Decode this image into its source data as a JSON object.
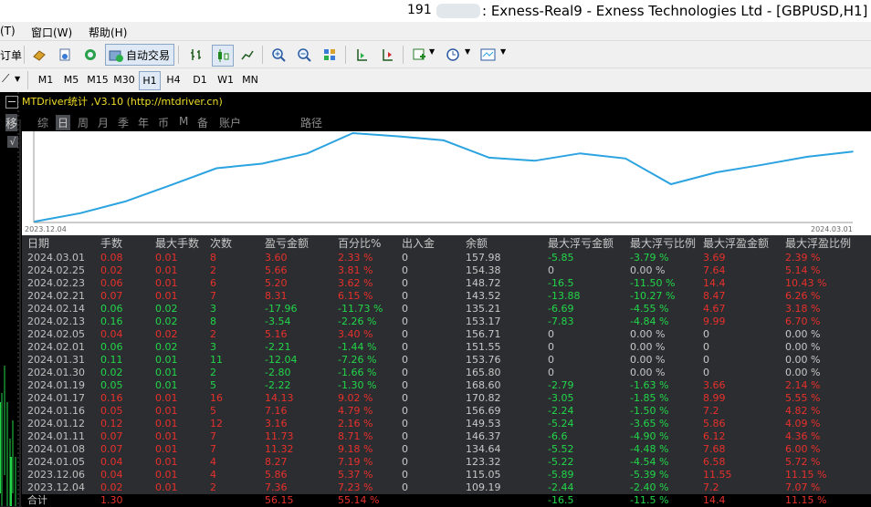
{
  "window": {
    "account_prefix": "191",
    "title": ": Exness-Real9 - Exness Technologies Ltd - [GBPUSD,H1]"
  },
  "menu": [
    "(T)",
    "窗口(W)",
    "帮助(H)"
  ],
  "toolbar": {
    "order_label": "订单",
    "auto_trade_label": "自动交易"
  },
  "timeframes": [
    "M1",
    "M5",
    "M15",
    "M30",
    "H1",
    "H4",
    "D1",
    "W1",
    "MN"
  ],
  "active_timeframe": "H1",
  "panel": {
    "title": "MTDriver统计 ,V3.10 (http://mtdriver.cn)",
    "tabs": [
      "综",
      "日",
      "周",
      "月",
      "季",
      "年",
      "币",
      "M",
      "备",
      "账户",
      "路径"
    ],
    "active_tab": "日",
    "side_tab_label": "移",
    "side_check": "√"
  },
  "chart_data": {
    "type": "line",
    "x_start_label": "2023.12.04",
    "x_end_label": "2024.03.01",
    "line_color": "#2aa3e0",
    "x": [
      "2023.12.04",
      "2023.12.06",
      "2024.01.05",
      "2024.01.08",
      "2024.01.11",
      "2024.01.12",
      "2024.01.16",
      "2024.01.17",
      "2024.01.19",
      "2024.01.30",
      "2024.01.31",
      "2024.02.01",
      "2024.02.05",
      "2024.02.13",
      "2024.02.14",
      "2024.02.21",
      "2024.02.23",
      "2024.02.25",
      "2024.03.01"
    ],
    "values": [
      109.19,
      115.05,
      123.32,
      134.64,
      146.37,
      149.53,
      156.69,
      170.82,
      168.6,
      165.8,
      153.76,
      151.55,
      156.71,
      153.17,
      135.21,
      143.52,
      148.72,
      154.38,
      157.98
    ]
  },
  "table": {
    "headers": [
      "日期",
      "手数",
      "最大手数",
      "次数",
      "盈亏金额",
      "百分比%",
      "出入金",
      "余额",
      "最大浮亏金额",
      "最大浮亏比例",
      "最大浮盈金额",
      "最大浮盈比例"
    ],
    "rows": [
      {
        "date": "2024.03.01",
        "lots": "0.08",
        "max_lots": "0.01",
        "count": "8",
        "pl": "3.60",
        "pct": "2.33 %",
        "dep": "0",
        "bal": "157.98",
        "mfl": "-5.85",
        "mflp": "-3.79 %",
        "mfp": "3.69",
        "mfpp": "2.39 %",
        "color": "red"
      },
      {
        "date": "2024.02.25",
        "lots": "0.02",
        "max_lots": "0.01",
        "count": "2",
        "pl": "5.66",
        "pct": "3.81 %",
        "dep": "0",
        "bal": "154.38",
        "mfl": "0",
        "mflp": "0.00 %",
        "mfp": "7.64",
        "mfpp": "5.14 %",
        "color": "red"
      },
      {
        "date": "2024.02.23",
        "lots": "0.06",
        "max_lots": "0.01",
        "count": "6",
        "pl": "5.20",
        "pct": "3.62 %",
        "dep": "0",
        "bal": "148.72",
        "mfl": "-16.5",
        "mflp": "-11.50 %",
        "mfp": "14.4",
        "mfpp": "10.43 %",
        "color": "red"
      },
      {
        "date": "2024.02.21",
        "lots": "0.07",
        "max_lots": "0.01",
        "count": "7",
        "pl": "8.31",
        "pct": "6.15 %",
        "dep": "0",
        "bal": "143.52",
        "mfl": "-13.88",
        "mflp": "-10.27 %",
        "mfp": "8.47",
        "mfpp": "6.26 %",
        "color": "red"
      },
      {
        "date": "2024.02.14",
        "lots": "0.06",
        "max_lots": "0.02",
        "count": "3",
        "pl": "-17.96",
        "pct": "-11.73 %",
        "dep": "0",
        "bal": "135.21",
        "mfl": "-6.69",
        "mflp": "-4.55 %",
        "mfp": "4.67",
        "mfpp": "3.18 %",
        "color": "green"
      },
      {
        "date": "2024.02.13",
        "lots": "0.16",
        "max_lots": "0.02",
        "count": "8",
        "pl": "-3.54",
        "pct": "-2.26 %",
        "dep": "0",
        "bal": "153.17",
        "mfl": "-7.83",
        "mflp": "-4.84 %",
        "mfp": "9.99",
        "mfpp": "6.70 %",
        "color": "green"
      },
      {
        "date": "2024.02.05",
        "lots": "0.04",
        "max_lots": "0.02",
        "count": "2",
        "pl": "5.16",
        "pct": "3.40 %",
        "dep": "0",
        "bal": "156.71",
        "mfl": "0",
        "mflp": "0.00 %",
        "mfp": "0",
        "mfpp": "0.00 %",
        "color": "red"
      },
      {
        "date": "2024.02.01",
        "lots": "0.06",
        "max_lots": "0.02",
        "count": "3",
        "pl": "-2.21",
        "pct": "-1.44 %",
        "dep": "0",
        "bal": "151.55",
        "mfl": "0",
        "mflp": "0.00 %",
        "mfp": "0",
        "mfpp": "0.00 %",
        "color": "green"
      },
      {
        "date": "2024.01.31",
        "lots": "0.11",
        "max_lots": "0.01",
        "count": "11",
        "pl": "-12.04",
        "pct": "-7.26 %",
        "dep": "0",
        "bal": "153.76",
        "mfl": "0",
        "mflp": "0.00 %",
        "mfp": "0",
        "mfpp": "0.00 %",
        "color": "green"
      },
      {
        "date": "2024.01.30",
        "lots": "0.02",
        "max_lots": "0.01",
        "count": "2",
        "pl": "-2.80",
        "pct": "-1.66 %",
        "dep": "0",
        "bal": "165.80",
        "mfl": "0",
        "mflp": "0.00 %",
        "mfp": "0",
        "mfpp": "0.00 %",
        "color": "green"
      },
      {
        "date": "2024.01.19",
        "lots": "0.05",
        "max_lots": "0.01",
        "count": "5",
        "pl": "-2.22",
        "pct": "-1.30 %",
        "dep": "0",
        "bal": "168.60",
        "mfl": "-2.79",
        "mflp": "-1.63 %",
        "mfp": "3.66",
        "mfpp": "2.14 %",
        "color": "green"
      },
      {
        "date": "2024.01.17",
        "lots": "0.16",
        "max_lots": "0.01",
        "count": "16",
        "pl": "14.13",
        "pct": "9.02 %",
        "dep": "0",
        "bal": "170.82",
        "mfl": "-3.05",
        "mflp": "-1.85 %",
        "mfp": "8.99",
        "mfpp": "5.55 %",
        "color": "red"
      },
      {
        "date": "2024.01.16",
        "lots": "0.05",
        "max_lots": "0.01",
        "count": "5",
        "pl": "7.16",
        "pct": "4.79 %",
        "dep": "0",
        "bal": "156.69",
        "mfl": "-2.24",
        "mflp": "-1.50 %",
        "mfp": "7.2",
        "mfpp": "4.82 %",
        "color": "red"
      },
      {
        "date": "2024.01.12",
        "lots": "0.12",
        "max_lots": "0.01",
        "count": "12",
        "pl": "3.16",
        "pct": "2.16 %",
        "dep": "0",
        "bal": "149.53",
        "mfl": "-5.24",
        "mflp": "-3.65 %",
        "mfp": "5.86",
        "mfpp": "4.09 %",
        "color": "red"
      },
      {
        "date": "2024.01.11",
        "lots": "0.07",
        "max_lots": "0.01",
        "count": "7",
        "pl": "11.73",
        "pct": "8.71 %",
        "dep": "0",
        "bal": "146.37",
        "mfl": "-6.6",
        "mflp": "-4.90 %",
        "mfp": "6.12",
        "mfpp": "4.36 %",
        "color": "red"
      },
      {
        "date": "2024.01.08",
        "lots": "0.07",
        "max_lots": "0.01",
        "count": "7",
        "pl": "11.32",
        "pct": "9.18 %",
        "dep": "0",
        "bal": "134.64",
        "mfl": "-5.52",
        "mflp": "-4.48 %",
        "mfp": "7.68",
        "mfpp": "6.00 %",
        "color": "red"
      },
      {
        "date": "2024.01.05",
        "lots": "0.04",
        "max_lots": "0.01",
        "count": "4",
        "pl": "8.27",
        "pct": "7.19 %",
        "dep": "0",
        "bal": "123.32",
        "mfl": "-5.22",
        "mflp": "-4.54 %",
        "mfp": "6.58",
        "mfpp": "5.72 %",
        "color": "red"
      },
      {
        "date": "2023.12.06",
        "lots": "0.04",
        "max_lots": "0.01",
        "count": "4",
        "pl": "5.86",
        "pct": "5.37 %",
        "dep": "0",
        "bal": "115.05",
        "mfl": "-5.89",
        "mflp": "-5.39 %",
        "mfp": "11.55",
        "mfpp": "11.15 %",
        "color": "red"
      },
      {
        "date": "2023.12.04",
        "lots": "0.02",
        "max_lots": "0.01",
        "count": "2",
        "pl": "7.36",
        "pct": "7.23 %",
        "dep": "0",
        "bal": "109.19",
        "mfl": "-2.44",
        "mflp": "-2.40 %",
        "mfp": "7.2",
        "mfpp": "7.07 %",
        "color": "red"
      }
    ],
    "total": {
      "label": "合计",
      "lots": "1.30",
      "pl": "56.15",
      "pct": "55.14 %",
      "mfl": "-16.5",
      "mflp": "-11.5 %",
      "mfp": "14.4",
      "mfpp": "11.15 %"
    }
  }
}
